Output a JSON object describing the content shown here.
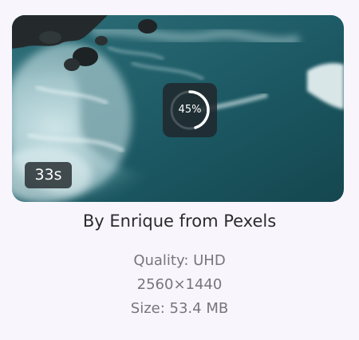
{
  "video": {
    "duration": "33s",
    "progress_label": "45%",
    "progress_fraction": 0.45,
    "author": "By Enrique from Pexels",
    "quality": "Quality: UHD",
    "resolution": "2560×1440",
    "size": "Size: 53.4 MB"
  },
  "colors": {
    "background": "#f8f6fc",
    "sea": "#1c5964",
    "progress_ring": "#ffffff"
  },
  "icons": {
    "progress": "circular-progress-icon"
  }
}
